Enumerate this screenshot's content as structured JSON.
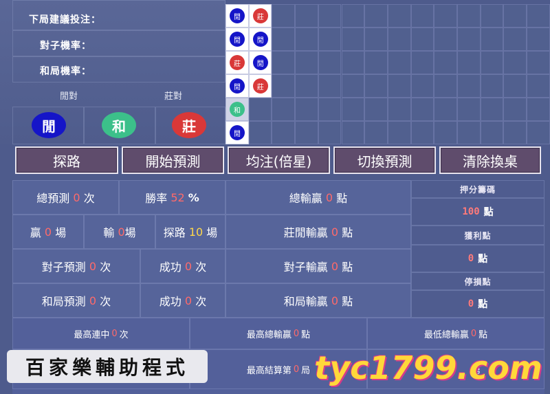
{
  "top_left": {
    "next_bet_label": "下局建議投注：",
    "pair_rate_label": "對子機率：",
    "tie_rate_label": "和局機率：",
    "player_pair_label": "閒對",
    "banker_pair_label": "莊對",
    "player_btn": "閒",
    "tie_btn": "和",
    "banker_btn": "莊"
  },
  "beads": {
    "col1": [
      "閒",
      "閒",
      "莊",
      "閒",
      "和",
      "閒"
    ],
    "col2": [
      "莊",
      "閒",
      "閒",
      "莊"
    ]
  },
  "menu": {
    "road_label": "探路",
    "start_label": "開始預測",
    "flat_bet_label": "均注(倍星)",
    "switch_label": "切換預測",
    "clear_label": "清除換桌"
  },
  "stats": {
    "total_pred_prefix": "總預測",
    "total_pred_value": "0",
    "total_pred_suffix": "次",
    "win_rate_prefix": "勝率",
    "win_rate_value": "52",
    "win_rate_suffix": "%",
    "total_win_loss_prefix": "總輸贏",
    "total_win_loss_value": "0",
    "total_win_loss_suffix": "點",
    "win_prefix": "贏",
    "win_value": "0",
    "win_suffix": "場",
    "lose_prefix": "輸",
    "lose_value": "0",
    "lose_suffix": "場",
    "road_prefix": "探路",
    "road_value": "10",
    "road_suffix": "場",
    "bp_win_loss_prefix": "莊閒輸贏",
    "bp_win_loss_value": "0",
    "bp_win_loss_suffix": "點",
    "pair_pred_prefix": "對子預測",
    "pair_pred_value": "0",
    "pair_pred_suffix": "次",
    "pair_success_prefix": "成功",
    "pair_success_value": "0",
    "pair_success_suffix": "次",
    "pair_win_loss_prefix": "對子輸贏",
    "pair_win_loss_value": "0",
    "pair_win_loss_suffix": "點",
    "tie_pred_prefix": "和局預測",
    "tie_pred_value": "0",
    "tie_pred_suffix": "次",
    "tie_success_prefix": "成功",
    "tie_success_value": "0",
    "tie_success_suffix": "次",
    "tie_win_loss_prefix": "和局輸贏",
    "tie_win_loss_value": "0",
    "tie_win_loss_suffix": "點"
  },
  "side": {
    "chip_label": "押分籌碼",
    "chip_value": "100",
    "chip_unit": "點",
    "profit_label": "獲利點",
    "profit_value": "0",
    "profit_unit": "點",
    "stop_loss_label": "停損點",
    "stop_loss_value": "0",
    "stop_loss_unit": "點"
  },
  "bottom": {
    "max_streak_prefix": "最高連中",
    "max_streak_value": "0",
    "max_streak_suffix": "次",
    "max_total_prefix": "最高總輸贏",
    "max_total_value": "0",
    "max_total_suffix": "點",
    "min_total_prefix": "最低總輸贏",
    "min_total_value": "0",
    "min_total_suffix": "點",
    "max_settle_prefix": "最高結算第",
    "max_settle_value": "0",
    "max_settle_suffix": "局",
    "third_partial": "第"
  },
  "overlay": {
    "caption": "百家樂輔助程式",
    "brand": "tyc1799.com"
  },
  "colors": {
    "player": "#1515c8",
    "banker": "#d93838",
    "tie": "#3cc08a",
    "highlight_number": "#ff6a6a",
    "brand_yellow": "#ffd83a"
  }
}
